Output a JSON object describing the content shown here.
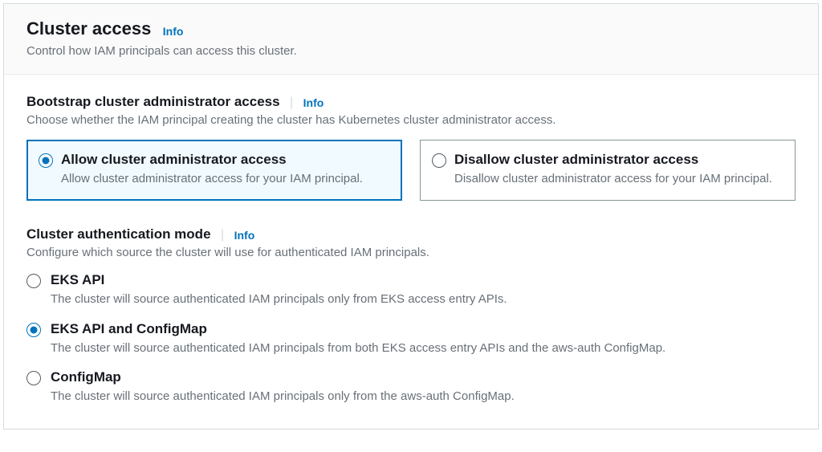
{
  "header": {
    "title": "Cluster access",
    "info": "Info",
    "desc": "Control how IAM principals can access this cluster."
  },
  "bootstrap": {
    "title": "Bootstrap cluster administrator access",
    "info": "Info",
    "desc": "Choose whether the IAM principal creating the cluster has Kubernetes cluster administrator access.",
    "allow": {
      "title": "Allow cluster administrator access",
      "desc": "Allow cluster administrator access for your IAM principal."
    },
    "disallow": {
      "title": "Disallow cluster administrator access",
      "desc": "Disallow cluster administrator access for your IAM principal."
    },
    "selected": "allow"
  },
  "authmode": {
    "title": "Cluster authentication mode",
    "info": "Info",
    "desc": "Configure which source the cluster will use for authenticated IAM principals.",
    "options": {
      "eks_api": {
        "title": "EKS API",
        "desc": "The cluster will source authenticated IAM principals only from EKS access entry APIs."
      },
      "eks_api_configmap": {
        "title": "EKS API and ConfigMap",
        "desc": "The cluster will source authenticated IAM principals from both EKS access entry APIs and the aws-auth ConfigMap."
      },
      "configmap": {
        "title": "ConfigMap",
        "desc": "The cluster will source authenticated IAM principals only from the aws-auth ConfigMap."
      }
    },
    "selected": "eks_api_configmap"
  }
}
